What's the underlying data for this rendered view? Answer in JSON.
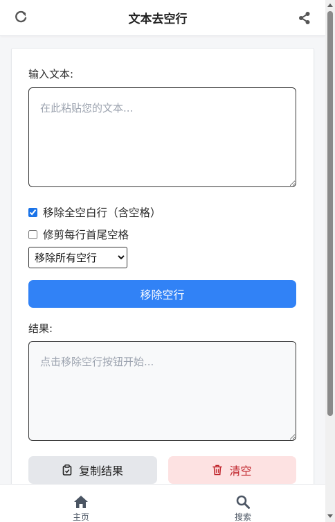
{
  "header": {
    "title": "文本去空行",
    "refresh_icon": "refresh-icon",
    "share_icon": "share-icon"
  },
  "input": {
    "label": "输入文本:",
    "placeholder": "在此粘贴您的文本...",
    "value": ""
  },
  "options": {
    "remove_whitespace_lines": {
      "label": "移除全空白行（含空格）",
      "checked": true
    },
    "trim_lines": {
      "label": "修剪每行首尾空格",
      "checked": false
    },
    "mode_select": {
      "selected": "移除所有空行"
    }
  },
  "actions": {
    "remove_button": "移除空行",
    "copy_button": "复制结果",
    "clear_button": "清空"
  },
  "result": {
    "label": "结果:",
    "placeholder": "点击移除空行按钮开始...",
    "value": ""
  },
  "nav": {
    "home": "主页",
    "search": "搜索"
  },
  "colors": {
    "primary": "#3182f6",
    "clear_bg": "#fde2e2",
    "clear_text": "#c0262d",
    "copy_bg": "#e5e7eb"
  }
}
